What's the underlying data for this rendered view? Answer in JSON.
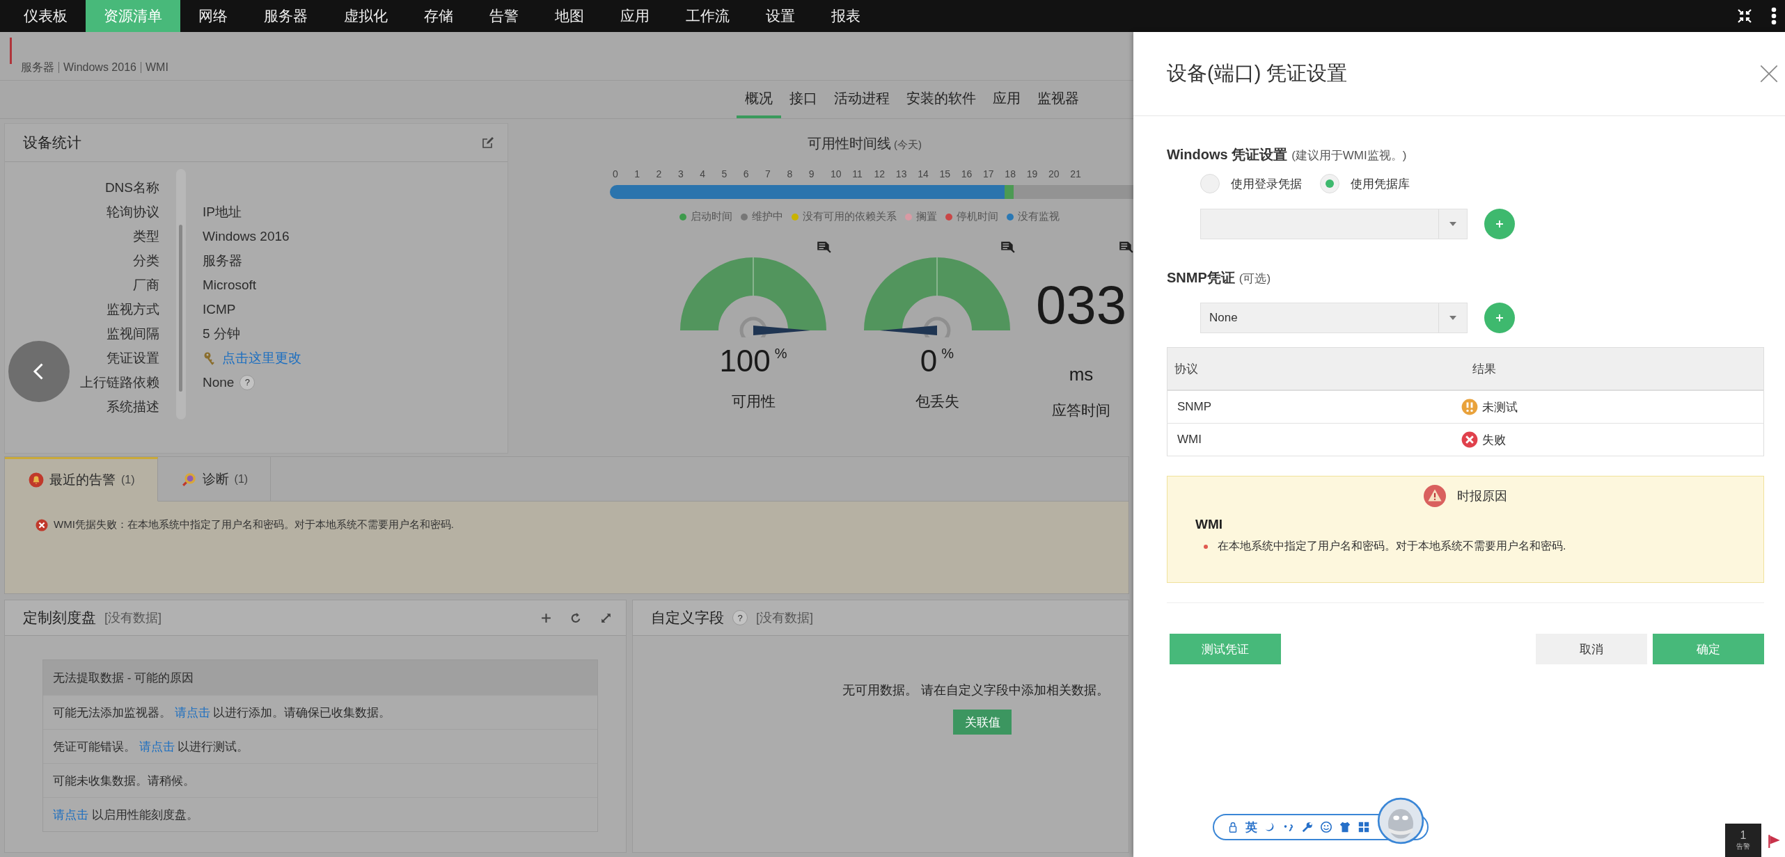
{
  "nav": {
    "items": [
      {
        "label": "仪表板",
        "selected": false
      },
      {
        "label": "资源清单",
        "selected": true
      },
      {
        "label": "网络",
        "selected": false
      },
      {
        "label": "服务器",
        "selected": false
      },
      {
        "label": "虚拟化",
        "selected": false
      },
      {
        "label": "存储",
        "selected": false
      },
      {
        "label": "告警",
        "selected": false
      },
      {
        "label": "地图",
        "selected": false
      },
      {
        "label": "应用",
        "selected": false
      },
      {
        "label": "工作流",
        "selected": false
      },
      {
        "label": "设置",
        "selected": false
      },
      {
        "label": "报表",
        "selected": false
      }
    ]
  },
  "breadcrumb": [
    "服务器",
    "Windows 2016",
    "WMI"
  ],
  "subtabs": [
    {
      "label": "概况",
      "selected": true
    },
    {
      "label": "接口",
      "selected": false
    },
    {
      "label": "活动进程",
      "selected": false
    },
    {
      "label": "安装的软件",
      "selected": false
    },
    {
      "label": "应用",
      "selected": false
    },
    {
      "label": "监视器",
      "selected": false
    }
  ],
  "device_stats": {
    "title": "设备统计",
    "fields": [
      {
        "label": "DNS名称",
        "kind": "empty"
      },
      {
        "label": "轮询协议",
        "kind": "text",
        "value": "IP地址"
      },
      {
        "label": "类型",
        "kind": "text",
        "value": "Windows 2016"
      },
      {
        "label": "分类",
        "kind": "text",
        "value": "服务器"
      },
      {
        "label": "厂商",
        "kind": "text",
        "value": "Microsoft"
      },
      {
        "label": "监视方式",
        "kind": "text",
        "value": "ICMP"
      },
      {
        "label": "监视间隔",
        "kind": "text",
        "value": "5 分钟"
      },
      {
        "label": "凭证设置",
        "kind": "link",
        "value": "点击这里更改"
      },
      {
        "label": "上行链路依赖",
        "kind": "help",
        "value": "None",
        "help": "?"
      },
      {
        "label": "系统描述",
        "kind": "empty"
      }
    ]
  },
  "availability": {
    "title": "可用性时间线",
    "subtitle": "(今天)",
    "hours": [
      "0",
      "1",
      "2",
      "3",
      "4",
      "5",
      "6",
      "7",
      "8",
      "9",
      "10",
      "11",
      "12",
      "13",
      "14",
      "15",
      "16",
      "17",
      "18",
      "19",
      "20",
      "21"
    ],
    "legend": [
      {
        "label": "启动时间",
        "color": "#3e9a4c"
      },
      {
        "label": "维护中",
        "color": "#777777"
      },
      {
        "label": "没有可用的依赖关系",
        "color": "#c9b300"
      },
      {
        "label": "搁置",
        "color": "#d99aa4"
      },
      {
        "label": "停机时间",
        "color": "#c94646"
      },
      {
        "label": "没有监视",
        "color": "#2a78b4"
      }
    ]
  },
  "gauges": [
    {
      "value": "100",
      "unit": "%",
      "label": "可用性"
    },
    {
      "value": "0",
      "unit": "%",
      "label": "包丢失"
    }
  ],
  "response": {
    "value": "033",
    "unit": "ms",
    "label": "应答时间"
  },
  "alerts": {
    "tabs": [
      {
        "label": "最近的告警",
        "count": "(1)",
        "selected": true,
        "kind": "alarm"
      },
      {
        "label": "诊断",
        "count": "(1)",
        "selected": false,
        "kind": "diagnosis"
      }
    ],
    "messages": [
      "WMI凭据失败：在本地系统中指定了用户名和密码。对于本地系统不需要用户名和密码."
    ]
  },
  "custom_dial": {
    "title": "定制刻度盘",
    "status": "[没有数据]",
    "notice_title": "无法提取数据 - 可能的原因",
    "reasons": [
      {
        "before": "可能无法添加监视器。 ",
        "link": "请点击",
        "after": " 以进行添加。请确保已收集数据。"
      },
      {
        "before": "凭证可能错误。 ",
        "link": "请点击",
        "after": " 以进行测试。"
      },
      {
        "before": "可能未收集数据。请稍候。"
      },
      {
        "link": "请点击",
        "after": " 以启用性能刻度盘。"
      }
    ]
  },
  "custom_fields": {
    "title": "自定义字段",
    "help": "?",
    "status": "[没有数据]",
    "message": "无可用数据。 请在自定义字段中添加相关数据。",
    "button": "关联值"
  },
  "drawer": {
    "title": "设备(端口) 凭证设置",
    "windows": {
      "title": "Windows 凭证设置",
      "hint": "(建议用于WMI监视。)",
      "options": [
        {
          "label": "使用登录凭据",
          "selected": false
        },
        {
          "label": "使用凭据库",
          "selected": true
        }
      ]
    },
    "snmp": {
      "title": "SNMP凭证",
      "hint": "(可选)",
      "value": "None"
    },
    "results": {
      "columns": [
        "协议",
        "结果"
      ],
      "rows": [
        {
          "protocol": "SNMP",
          "result": "未测试",
          "kind": "untested"
        },
        {
          "protocol": "WMI",
          "result": "失败",
          "kind": "failed"
        }
      ]
    },
    "reason": {
      "title": "时报原因",
      "protocol": "WMI",
      "items": [
        "在本地系统中指定了用户名和密码。对于本地系统不需要用户名和密码."
      ]
    },
    "buttons": {
      "test": "测试凭证",
      "cancel": "取消",
      "ok": "确定"
    }
  },
  "ime_toolbar": {
    "label": "英"
  },
  "alert_counter": {
    "count": "1",
    "label": "告警"
  }
}
